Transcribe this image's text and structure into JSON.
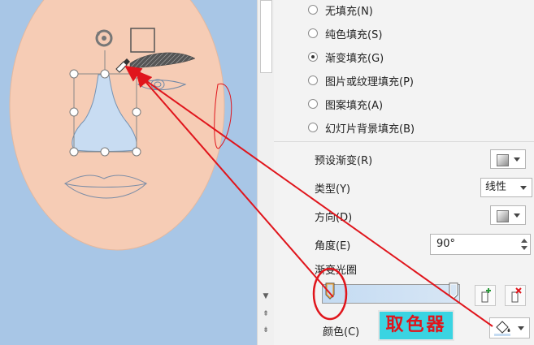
{
  "fill_options": [
    {
      "label": "无填充(N)",
      "checked": false
    },
    {
      "label": "纯色填充(S)",
      "checked": false
    },
    {
      "label": "渐变填充(G)",
      "checked": true
    },
    {
      "label": "图片或纹理填充(P)",
      "checked": false
    },
    {
      "label": "图案填充(A)",
      "checked": false
    },
    {
      "label": "幻灯片背景填充(B)",
      "checked": false
    }
  ],
  "gradient": {
    "preset_label": "预设渐变(R)",
    "type_label": "类型(Y)",
    "type_value": "线性",
    "direction_label": "方向(D)",
    "angle_label": "角度(E)",
    "angle_value": "90°",
    "stops_label": "渐变光圈",
    "color_label": "颜色(C)"
  },
  "callout": {
    "text": "取色器"
  },
  "colors": {
    "canvas_bg": "#a8c6e6",
    "face": "#f6ccb5",
    "nose_fill": "#c8dcf2",
    "annotation": "#e0151c",
    "callout_bg": "#3ad4e2"
  },
  "icons": [
    "rotate-handle-icon",
    "eyedropper-icon",
    "add-stop-icon",
    "remove-stop-icon",
    "fill-bucket-icon"
  ]
}
